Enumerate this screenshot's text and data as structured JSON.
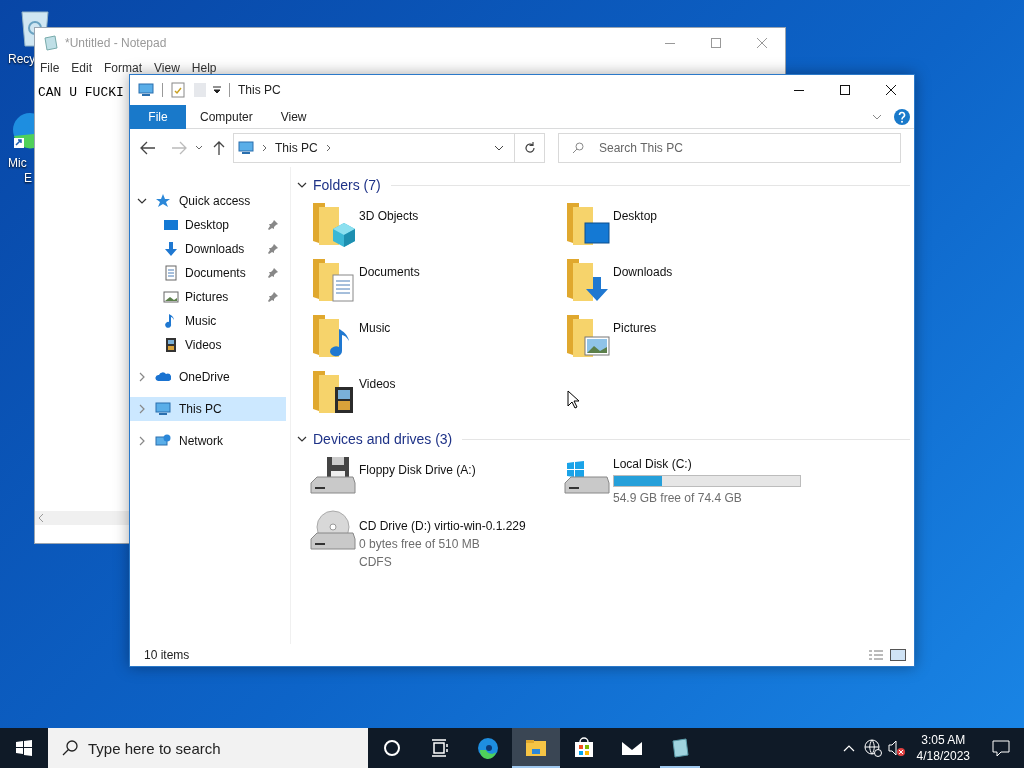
{
  "desktop": {
    "icons": [
      {
        "kind": "recycle-bin",
        "label_lines": [
          "Recy"
        ]
      },
      {
        "kind": "browser",
        "label_lines": [
          "Mic",
          "E"
        ]
      }
    ]
  },
  "notepad": {
    "title": "*Untitled - Notepad",
    "menu": [
      "File",
      "Edit",
      "Format",
      "View",
      "Help"
    ],
    "text": "CAN U FUCKI"
  },
  "explorer": {
    "title": "This PC",
    "ribbon": {
      "file_button": "File",
      "tabs": [
        "Computer",
        "View"
      ]
    },
    "history": {
      "back": {
        "disabled": false
      },
      "forward": {
        "disabled": true
      }
    },
    "address": {
      "crumbs": [
        "This PC"
      ]
    },
    "search": {
      "placeholder": "Search This PC"
    },
    "nav_pane": [
      {
        "kind": "quick-access",
        "label": "Quick access",
        "expanded": true,
        "selected": false,
        "children": [
          {
            "kind": "desktop",
            "label": "Desktop",
            "pinned": true
          },
          {
            "kind": "downloads",
            "label": "Downloads",
            "pinned": true
          },
          {
            "kind": "documents",
            "label": "Documents",
            "pinned": true
          },
          {
            "kind": "pictures",
            "label": "Pictures",
            "pinned": true
          },
          {
            "kind": "music",
            "label": "Music",
            "pinned": false
          },
          {
            "kind": "videos",
            "label": "Videos",
            "pinned": false
          }
        ]
      },
      {
        "kind": "onedrive",
        "label": "OneDrive",
        "expanded": false,
        "selected": false
      },
      {
        "kind": "this-pc",
        "label": "This PC",
        "expanded": false,
        "selected": true
      },
      {
        "kind": "network",
        "label": "Network",
        "expanded": false,
        "selected": false
      }
    ],
    "sections": [
      {
        "title": "Folders (7)",
        "expanded": true,
        "items": [
          {
            "kind": "objects",
            "name": "3D Objects"
          },
          {
            "kind": "desktop",
            "name": "Desktop"
          },
          {
            "kind": "documents",
            "name": "Documents"
          },
          {
            "kind": "downloads",
            "name": "Downloads"
          },
          {
            "kind": "music",
            "name": "Music"
          },
          {
            "kind": "pictures",
            "name": "Pictures"
          },
          {
            "kind": "videos",
            "name": "Videos"
          }
        ]
      },
      {
        "title": "Devices and drives (3)",
        "expanded": true,
        "items": [
          {
            "kind": "floppy",
            "name": "Floppy Disk Drive (A:)"
          },
          {
            "kind": "system-disk",
            "name": "Local Disk (C:)",
            "level": 0.26,
            "details": [
              "54.9 GB free of 74.4 GB"
            ]
          },
          {
            "kind": "cd",
            "name": "CD Drive (D:) virtio-win-0.1.229",
            "details": [
              "0 bytes free of 510 MB",
              "CDFS"
            ]
          }
        ]
      }
    ],
    "status": "10 items"
  },
  "taskbar": {
    "search_placeholder": "Type here to search",
    "apps": [
      {
        "kind": "cortana",
        "active": false,
        "running": false
      },
      {
        "kind": "task-view",
        "active": false,
        "running": false
      },
      {
        "kind": "edge",
        "active": false,
        "running": false
      },
      {
        "kind": "file-explorer",
        "active": true,
        "running": true
      },
      {
        "kind": "store",
        "active": false,
        "running": false
      },
      {
        "kind": "mail",
        "active": false,
        "running": false
      },
      {
        "kind": "notepad",
        "active": false,
        "running": true
      }
    ],
    "time": "3:05 AM",
    "date": "4/18/2023"
  }
}
